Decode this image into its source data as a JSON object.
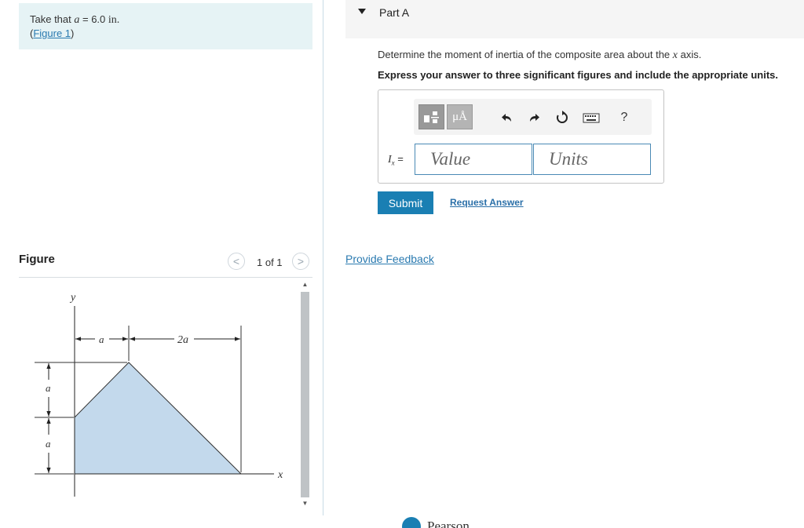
{
  "given": {
    "prefix": "Take that ",
    "variable": "a",
    "equals": " = 6.0 ",
    "unit": "in.",
    "figure_link": "Figure 1",
    "open_paren": "(",
    "close_paren": ")"
  },
  "figure_panel": {
    "title": "Figure",
    "prev_icon": "chevron-left-icon",
    "next_icon": "chevron-right-icon",
    "prev_glyph": "<",
    "next_glyph": ">",
    "page_count": "1 of 1",
    "labels": {
      "y_axis": "y",
      "x_axis": "x",
      "dim_a_top": "a",
      "dim_2a_top": "2a",
      "dim_a_left_upper": "a",
      "dim_a_left_lower": "a"
    },
    "fill_color": "#c3d9ec"
  },
  "part": {
    "title": "Part A",
    "question": "Determine the moment of inertia of the composite area about the ",
    "question_axis": "x",
    "question_suffix": " axis.",
    "instruction": "Express your answer to three significant figures and include the appropriate units."
  },
  "toolbar": {
    "templates_icon": "templates-icon",
    "units_label": "μÅ",
    "undo_icon": "undo-icon",
    "redo_icon": "redo-icon",
    "reset_icon": "reset-icon",
    "keyboard_icon": "keyboard-icon",
    "help_label": "?"
  },
  "answer": {
    "symbol": "I",
    "subscript": "x",
    "equals": " =",
    "value_placeholder": "Value",
    "units_placeholder": "Units"
  },
  "actions": {
    "submit": "Submit",
    "request_answer": "Request Answer",
    "provide_feedback": "Provide Feedback"
  },
  "footer": {
    "brand": "Pearson"
  },
  "colors": {
    "accent": "#1a7fb3",
    "link": "#2a7ab0",
    "info_bg": "#e6f3f5"
  }
}
